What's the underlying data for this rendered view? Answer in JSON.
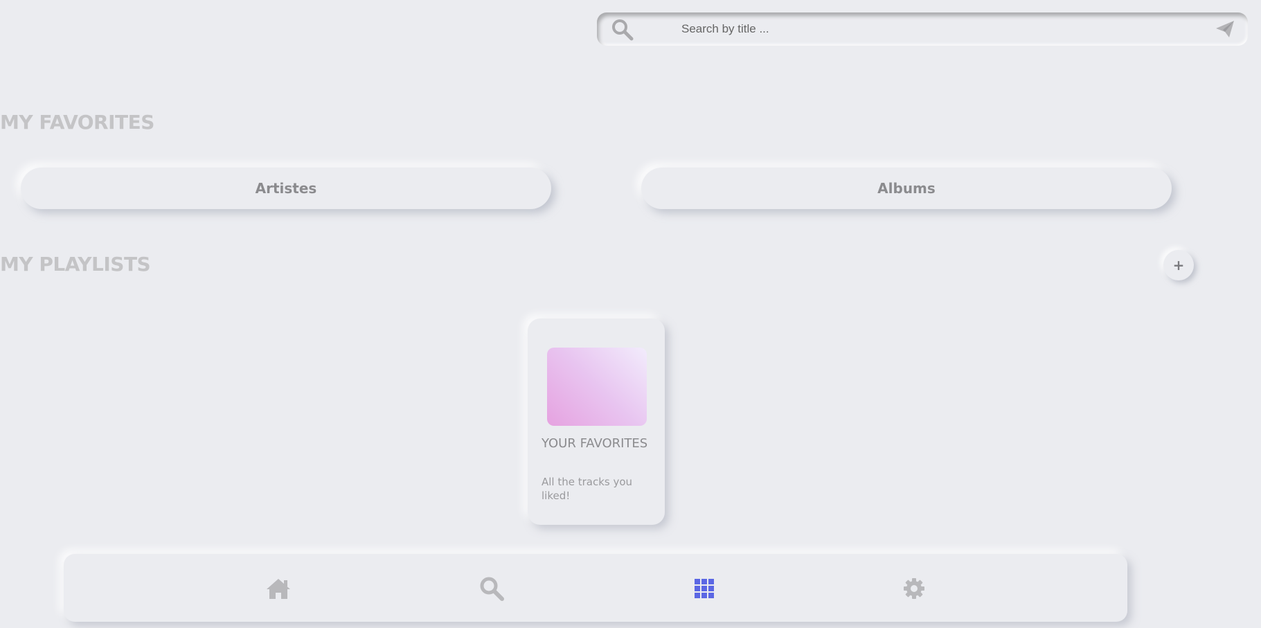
{
  "search": {
    "placeholder": "Search by title ...",
    "search_icon": "search-icon",
    "submit_icon": "paper-plane-icon"
  },
  "favorites": {
    "title": "MY FAVORITES",
    "buttons": [
      {
        "label": "Artistes"
      },
      {
        "label": "Albums"
      }
    ]
  },
  "playlists": {
    "title": "MY PLAYLISTS",
    "add_label": "+",
    "items": [
      {
        "name": "YOUR FAVORITES",
        "description": "All the tracks you liked!",
        "cover_gradient": [
          "#e6a2e0",
          "#f2ecfc"
        ]
      }
    ]
  },
  "nav": {
    "items": [
      {
        "icon": "home-icon",
        "active": false
      },
      {
        "icon": "search-icon",
        "active": false
      },
      {
        "icon": "grid-icon",
        "active": true
      },
      {
        "icon": "gear-icon",
        "active": false
      }
    ],
    "active_color": "#5b67e4",
    "inactive_color": "#b8b8bb"
  }
}
